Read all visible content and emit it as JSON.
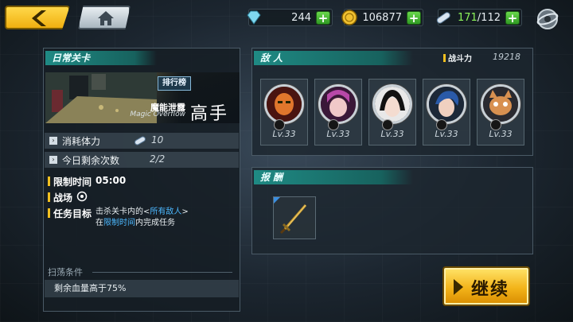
{
  "topbar": {
    "gems": "244",
    "coins": "106877",
    "energy_current": "171",
    "energy_sep_max": "/112"
  },
  "stage": {
    "panel_title": "日常关卡",
    "name_cn": "魔能泄露",
    "name_en": "Magic Overflow",
    "difficulty": "高手",
    "rank_label": "排行榜",
    "cost_label": "消耗体力",
    "cost_value": "10",
    "remaining_label": "今日剩余次数",
    "remaining_value": "2/2",
    "time_limit_label": "限制时间",
    "time_limit_value": "05:00",
    "battlefield_label": "战场",
    "objective_label": "任务目标",
    "objective_line1_a": "击杀关卡内的<",
    "objective_line1_hl": "所有敌人",
    "objective_line1_b": ">",
    "objective_line2_a": "在",
    "objective_line2_hl": "限制时间",
    "objective_line2_b": "内完成任务",
    "sweep_title": "扫荡条件",
    "sweep_condition": "剩余血量高于75%"
  },
  "enemies": {
    "title": "敌 人",
    "power_label": "战斗力",
    "power_value": "19218",
    "list": [
      {
        "level": "Lv.33"
      },
      {
        "level": "Lv.33"
      },
      {
        "level": "Lv.33"
      },
      {
        "level": "Lv.33"
      },
      {
        "level": "Lv.33"
      }
    ]
  },
  "rewards": {
    "title": "报 酬"
  },
  "continue_label": "继续",
  "colors": {
    "accent_teal": "#1f8a84",
    "button_yellow": "#f3b41a",
    "highlight_blue": "#4cb8ff",
    "plus_green": "#2f9a23"
  }
}
